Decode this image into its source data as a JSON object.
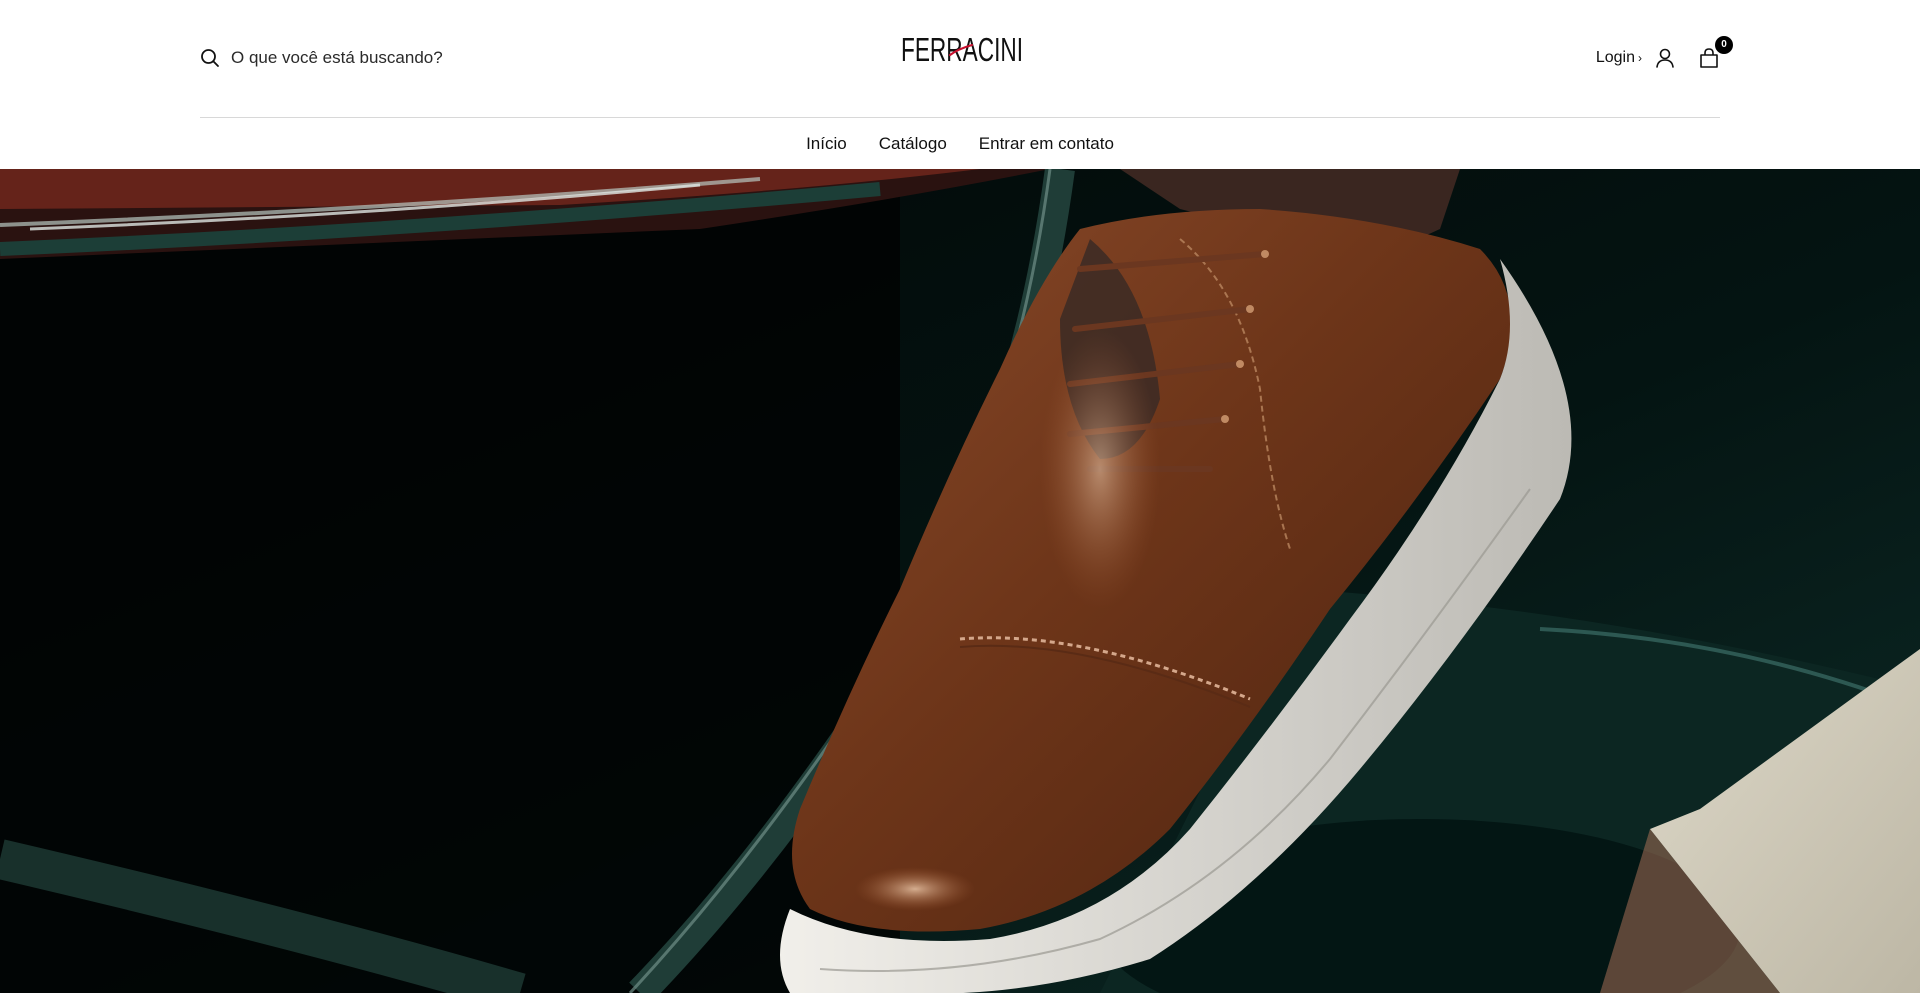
{
  "search": {
    "placeholder": "O que você está buscando?",
    "icon": "search-icon"
  },
  "logo": {
    "text": "FERRACINI",
    "accent_color": "#c8102e"
  },
  "account": {
    "login_label": "Login",
    "login_chevron": "›",
    "user_icon": "user-icon",
    "cart_icon": "shopping-bag-icon",
    "cart_count": "0"
  },
  "nav": {
    "items": [
      {
        "label": "Início"
      },
      {
        "label": "Catálogo"
      },
      {
        "label": "Entrar em contato"
      }
    ]
  },
  "hero": {
    "image": "brown leather derby shoe with white sole in car interior",
    "colors": {
      "background": "#020404",
      "leather": "#7a3f22",
      "sole": "#d9d7d2",
      "car_green": "#0f2a26"
    }
  }
}
